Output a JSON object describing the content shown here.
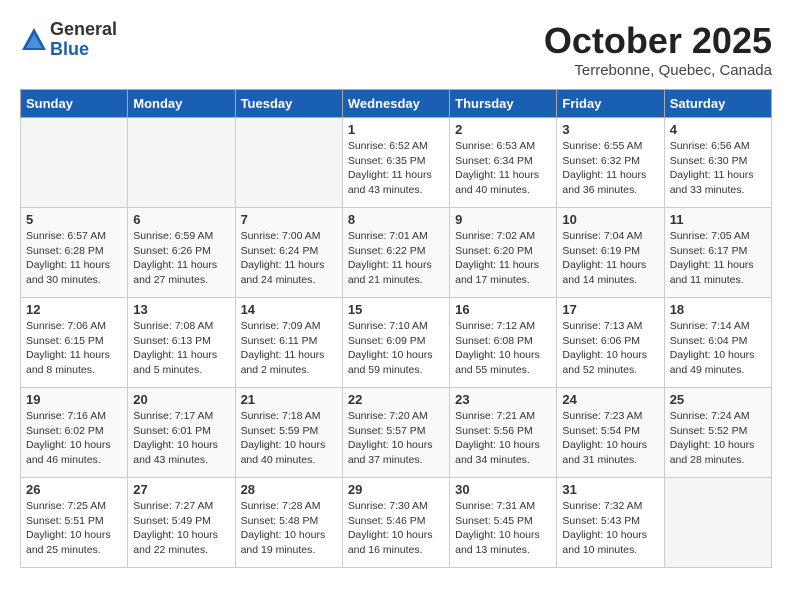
{
  "header": {
    "logo_general": "General",
    "logo_blue": "Blue",
    "month_title": "October 2025",
    "location": "Terrebonne, Quebec, Canada"
  },
  "days_of_week": [
    "Sunday",
    "Monday",
    "Tuesday",
    "Wednesday",
    "Thursday",
    "Friday",
    "Saturday"
  ],
  "weeks": [
    [
      {
        "day": "",
        "empty": true
      },
      {
        "day": "",
        "empty": true
      },
      {
        "day": "",
        "empty": true
      },
      {
        "day": "1",
        "sunrise": "6:52 AM",
        "sunset": "6:35 PM",
        "daylight": "11 hours and 43 minutes."
      },
      {
        "day": "2",
        "sunrise": "6:53 AM",
        "sunset": "6:34 PM",
        "daylight": "11 hours and 40 minutes."
      },
      {
        "day": "3",
        "sunrise": "6:55 AM",
        "sunset": "6:32 PM",
        "daylight": "11 hours and 36 minutes."
      },
      {
        "day": "4",
        "sunrise": "6:56 AM",
        "sunset": "6:30 PM",
        "daylight": "11 hours and 33 minutes."
      }
    ],
    [
      {
        "day": "5",
        "sunrise": "6:57 AM",
        "sunset": "6:28 PM",
        "daylight": "11 hours and 30 minutes."
      },
      {
        "day": "6",
        "sunrise": "6:59 AM",
        "sunset": "6:26 PM",
        "daylight": "11 hours and 27 minutes."
      },
      {
        "day": "7",
        "sunrise": "7:00 AM",
        "sunset": "6:24 PM",
        "daylight": "11 hours and 24 minutes."
      },
      {
        "day": "8",
        "sunrise": "7:01 AM",
        "sunset": "6:22 PM",
        "daylight": "11 hours and 21 minutes."
      },
      {
        "day": "9",
        "sunrise": "7:02 AM",
        "sunset": "6:20 PM",
        "daylight": "11 hours and 17 minutes."
      },
      {
        "day": "10",
        "sunrise": "7:04 AM",
        "sunset": "6:19 PM",
        "daylight": "11 hours and 14 minutes."
      },
      {
        "day": "11",
        "sunrise": "7:05 AM",
        "sunset": "6:17 PM",
        "daylight": "11 hours and 11 minutes."
      }
    ],
    [
      {
        "day": "12",
        "sunrise": "7:06 AM",
        "sunset": "6:15 PM",
        "daylight": "11 hours and 8 minutes."
      },
      {
        "day": "13",
        "sunrise": "7:08 AM",
        "sunset": "6:13 PM",
        "daylight": "11 hours and 5 minutes."
      },
      {
        "day": "14",
        "sunrise": "7:09 AM",
        "sunset": "6:11 PM",
        "daylight": "11 hours and 2 minutes."
      },
      {
        "day": "15",
        "sunrise": "7:10 AM",
        "sunset": "6:09 PM",
        "daylight": "10 hours and 59 minutes."
      },
      {
        "day": "16",
        "sunrise": "7:12 AM",
        "sunset": "6:08 PM",
        "daylight": "10 hours and 55 minutes."
      },
      {
        "day": "17",
        "sunrise": "7:13 AM",
        "sunset": "6:06 PM",
        "daylight": "10 hours and 52 minutes."
      },
      {
        "day": "18",
        "sunrise": "7:14 AM",
        "sunset": "6:04 PM",
        "daylight": "10 hours and 49 minutes."
      }
    ],
    [
      {
        "day": "19",
        "sunrise": "7:16 AM",
        "sunset": "6:02 PM",
        "daylight": "10 hours and 46 minutes."
      },
      {
        "day": "20",
        "sunrise": "7:17 AM",
        "sunset": "6:01 PM",
        "daylight": "10 hours and 43 minutes."
      },
      {
        "day": "21",
        "sunrise": "7:18 AM",
        "sunset": "5:59 PM",
        "daylight": "10 hours and 40 minutes."
      },
      {
        "day": "22",
        "sunrise": "7:20 AM",
        "sunset": "5:57 PM",
        "daylight": "10 hours and 37 minutes."
      },
      {
        "day": "23",
        "sunrise": "7:21 AM",
        "sunset": "5:56 PM",
        "daylight": "10 hours and 34 minutes."
      },
      {
        "day": "24",
        "sunrise": "7:23 AM",
        "sunset": "5:54 PM",
        "daylight": "10 hours and 31 minutes."
      },
      {
        "day": "25",
        "sunrise": "7:24 AM",
        "sunset": "5:52 PM",
        "daylight": "10 hours and 28 minutes."
      }
    ],
    [
      {
        "day": "26",
        "sunrise": "7:25 AM",
        "sunset": "5:51 PM",
        "daylight": "10 hours and 25 minutes."
      },
      {
        "day": "27",
        "sunrise": "7:27 AM",
        "sunset": "5:49 PM",
        "daylight": "10 hours and 22 minutes."
      },
      {
        "day": "28",
        "sunrise": "7:28 AM",
        "sunset": "5:48 PM",
        "daylight": "10 hours and 19 minutes."
      },
      {
        "day": "29",
        "sunrise": "7:30 AM",
        "sunset": "5:46 PM",
        "daylight": "10 hours and 16 minutes."
      },
      {
        "day": "30",
        "sunrise": "7:31 AM",
        "sunset": "5:45 PM",
        "daylight": "10 hours and 13 minutes."
      },
      {
        "day": "31",
        "sunrise": "7:32 AM",
        "sunset": "5:43 PM",
        "daylight": "10 hours and 10 minutes."
      },
      {
        "day": "",
        "empty": true
      }
    ]
  ]
}
